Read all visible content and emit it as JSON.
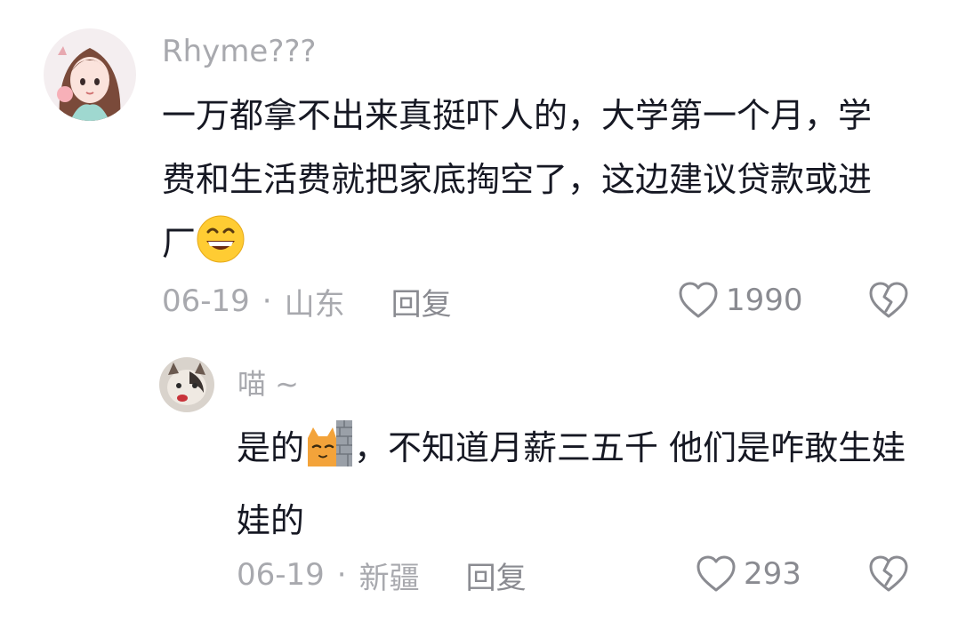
{
  "comments": [
    {
      "username": "Rhyme???",
      "text": "一万都拿不出来真挺吓人的，大学第一个月，学费和生活费就把家底掏空了，这边建议贷款或进厂",
      "emoji": "grinning-face",
      "date": "06-19",
      "separator": "·",
      "location": "山东",
      "reply_label": "回复",
      "likes": "1990"
    }
  ],
  "replies": [
    {
      "username": "喵 ~",
      "text_before_emoji": "是的",
      "emoji": "cat-behind-wall",
      "text_after_emoji": "，不知道月薪三五千  他们是咋敢生娃娃的",
      "date": "06-19",
      "separator": "·",
      "location": "新疆",
      "reply_label": "回复",
      "likes": "293"
    }
  ],
  "icons": {
    "like": "heart-outline-icon",
    "dislike": "broken-heart-icon"
  },
  "colors": {
    "text": "#161823",
    "muted": "#a8a9ae",
    "icon": "#8a8b91"
  }
}
